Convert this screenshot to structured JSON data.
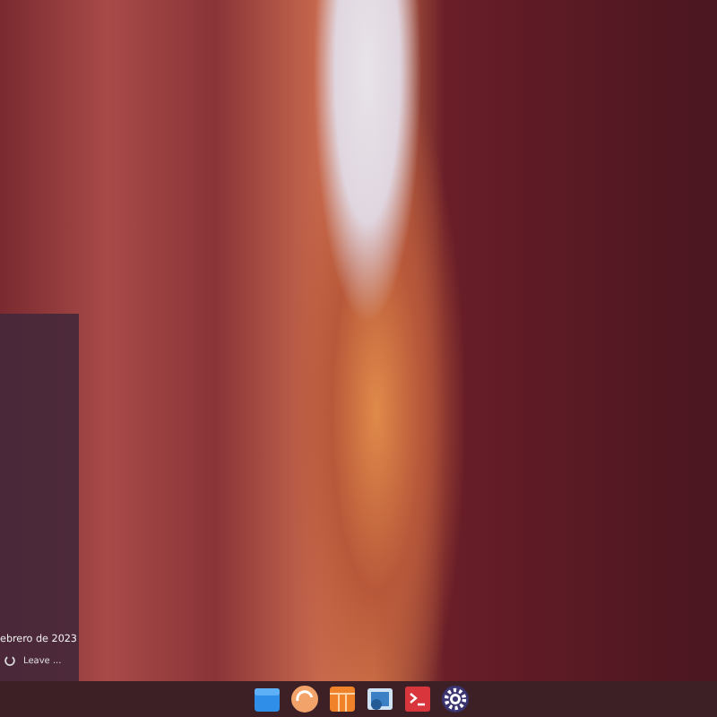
{
  "menu_panel": {
    "date": "ebrero de 2023",
    "leave_button": {
      "label": "Leave ..."
    }
  }
}
